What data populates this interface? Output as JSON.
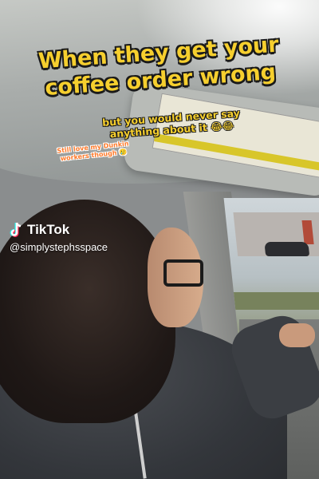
{
  "overlay": {
    "title": "When they get your coffee order wrong",
    "subtitle": "but you would never say anything about it 😂😂",
    "note": "Still love my Dunkin workers though 🥲"
  },
  "watermark": {
    "brand": "TikTok",
    "handle": "@simplystephsspace",
    "icon": "tiktok-logo-icon"
  },
  "colors": {
    "title_text": "#f6cf2e",
    "note_text": "#ff7a2a"
  }
}
